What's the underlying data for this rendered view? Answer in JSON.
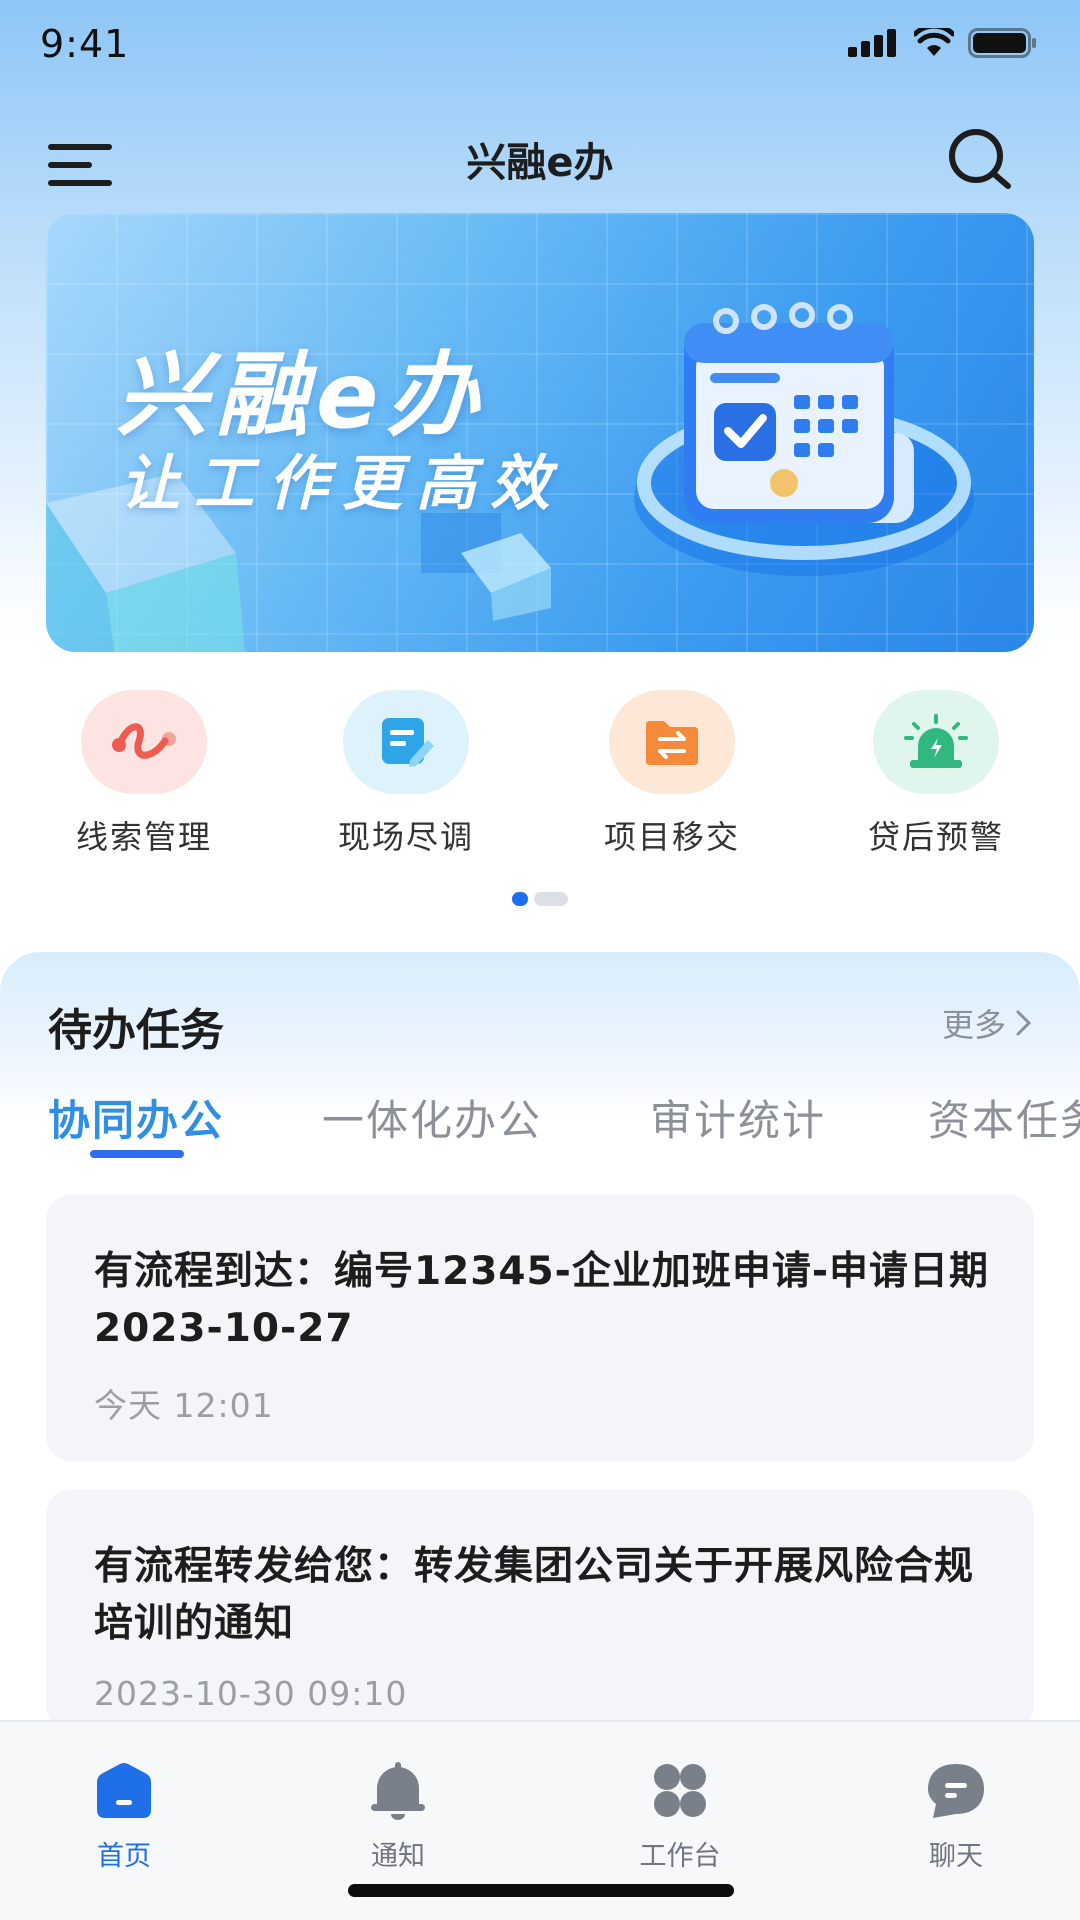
{
  "status_bar": {
    "time": "9:41"
  },
  "header": {
    "title": "兴融e办"
  },
  "banner": {
    "title": "兴融e办",
    "subtitle": "让工作更高效"
  },
  "quick_menu": [
    {
      "label": "线索管理",
      "icon": "clue-icon",
      "bg": "#fde4e2",
      "color": "#ee5b4f"
    },
    {
      "label": "现场尽调",
      "icon": "survey-edit-icon",
      "bg": "#def2fc",
      "color": "#2ea5e8"
    },
    {
      "label": "项目移交",
      "icon": "folder-transfer-icon",
      "bg": "#fde8d8",
      "color": "#f58a3c"
    },
    {
      "label": "贷后预警",
      "icon": "alarm-icon",
      "bg": "#e0f6ec",
      "color": "#2fb980"
    }
  ],
  "pager": {
    "total": 2,
    "active": 1
  },
  "tasks": {
    "title": "待办任务",
    "more": "更多",
    "tabs": [
      "协同办公",
      "一体化办公",
      "审计统计",
      "资本任务"
    ],
    "active_tab": 0,
    "items": [
      {
        "text": "有流程到达：编号12345-企业加班申请-申请日期2023-10-27",
        "time": "今天   12:01"
      },
      {
        "text": "有流程转发给您：转发集团公司关于开展风险合规培训的通知",
        "time": "2023-10-30   09:10"
      }
    ]
  },
  "bottom_nav": [
    {
      "label": "首页",
      "icon": "home-icon",
      "active": true
    },
    {
      "label": "通知",
      "icon": "bell-icon",
      "active": false
    },
    {
      "label": "工作台",
      "icon": "workbench-icon",
      "active": false
    },
    {
      "label": "聊天",
      "icon": "chat-icon",
      "active": false
    }
  ],
  "colors": {
    "accent": "#1f6fe8",
    "tab_active": "#2f8ee5",
    "text": "#1d1d1d",
    "muted": "#8c9099"
  }
}
